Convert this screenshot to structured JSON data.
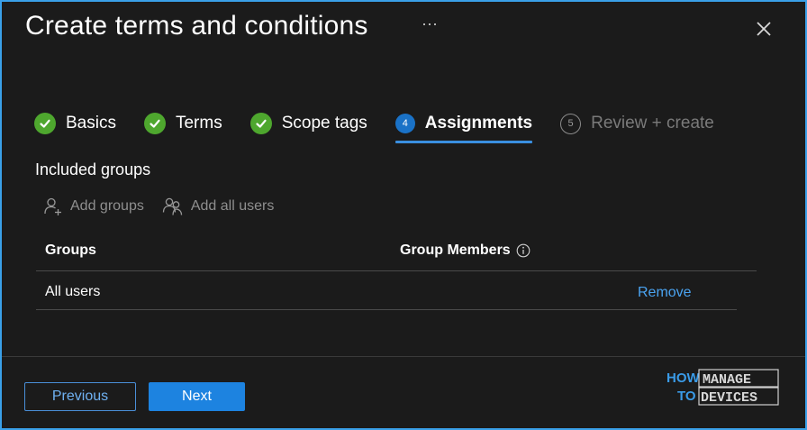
{
  "header": {
    "title": "Create terms and conditions",
    "more_label": "···"
  },
  "steps": [
    {
      "label": "Basics",
      "state": "done",
      "icon": "checkmark-icon"
    },
    {
      "label": "Terms",
      "state": "done",
      "icon": "checkmark-icon"
    },
    {
      "label": "Scope tags",
      "state": "done",
      "icon": "checkmark-icon"
    },
    {
      "label": "Assignments",
      "state": "current",
      "number": "4"
    },
    {
      "label": "Review + create",
      "state": "future",
      "number": "5"
    }
  ],
  "section": {
    "heading": "Included groups"
  },
  "commands": {
    "add_groups": "Add groups",
    "add_all_users": "Add all users"
  },
  "table": {
    "columns": [
      "Groups",
      "Group Members"
    ],
    "rows": [
      {
        "group": "All users",
        "action": "Remove"
      }
    ]
  },
  "footer": {
    "previous": "Previous",
    "next": "Next"
  },
  "logo": {
    "line1": "HOW",
    "line2": "TO",
    "word1": "MANAGE",
    "word2": "DEVICES"
  },
  "colors": {
    "accent": "#1d83e0",
    "done": "#4ea72e",
    "link": "#4aa3f0",
    "frame": "#3aa0e8"
  }
}
